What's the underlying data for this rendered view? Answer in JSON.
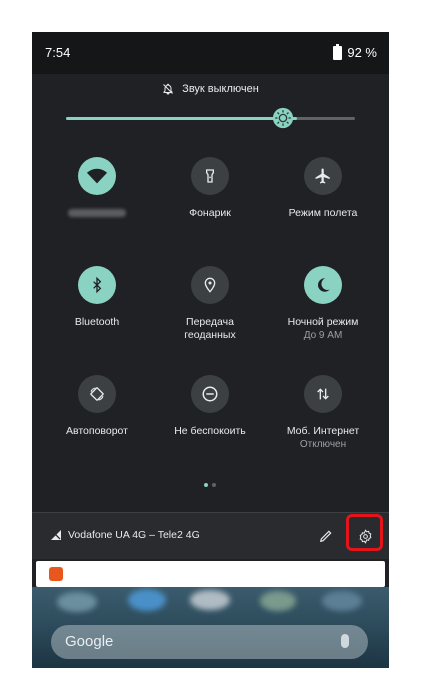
{
  "status_bar": {
    "time": "7:54",
    "battery": "92 %"
  },
  "sound": {
    "label": "Звук выключен"
  },
  "brightness": {
    "level": 0.8
  },
  "tiles": [
    {
      "id": "wifi",
      "label": "",
      "sub": "",
      "on": true,
      "icon": "wifi-icon"
    },
    {
      "id": "flashlight",
      "label": "Фонарик",
      "sub": "",
      "on": false,
      "icon": "flashlight-icon"
    },
    {
      "id": "airplane",
      "label": "Режим полета",
      "sub": "",
      "on": false,
      "icon": "airplane-icon"
    },
    {
      "id": "bluetooth",
      "label": "Bluetooth",
      "sub": "",
      "on": true,
      "icon": "bluetooth-icon"
    },
    {
      "id": "location",
      "label": "Передача геоданных",
      "sub": "",
      "on": false,
      "icon": "location-icon"
    },
    {
      "id": "night",
      "label": "Ночной режим",
      "sub": "До 9 AM",
      "on": true,
      "icon": "moon-icon"
    },
    {
      "id": "rotate",
      "label": "Автоповорот",
      "sub": "",
      "on": false,
      "icon": "auto-rotate-icon"
    },
    {
      "id": "dnd",
      "label": "Не беспокоить",
      "sub": "",
      "on": false,
      "icon": "do-not-disturb-icon"
    },
    {
      "id": "mobile-data",
      "label": "Моб. Интернет",
      "sub": "Отключен",
      "on": false,
      "icon": "mobile-data-icon"
    }
  ],
  "footer": {
    "carrier": "Vodafone UA 4G – Tele2 4G"
  },
  "wallpaper": {
    "search_text": "Google"
  },
  "colors": {
    "accent": "#8ad2c2",
    "panel": "#202124",
    "tile_off": "#3c4043",
    "highlight": "#e4141b",
    "notification_icon": "#e8571e"
  }
}
